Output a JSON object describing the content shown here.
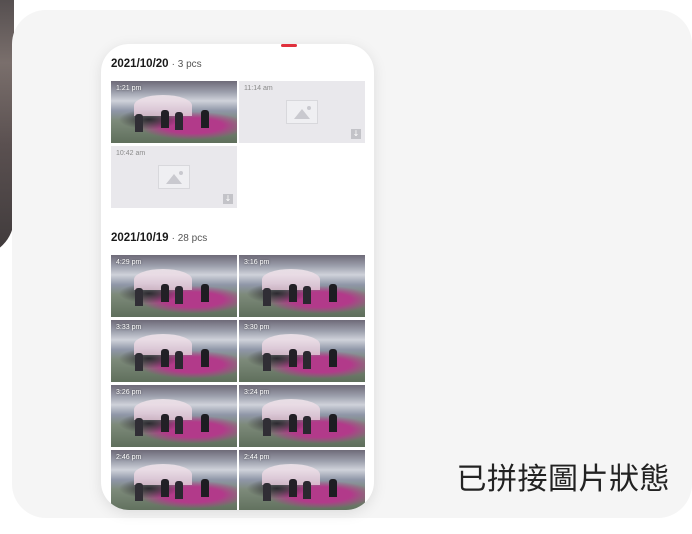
{
  "caption": "已拼接圖片狀態",
  "groups": [
    {
      "date": "2021/10/20",
      "count": "· 3 pcs",
      "items": [
        {
          "time": "1:21 pm",
          "state": "stitched"
        },
        {
          "time": "11:14 am",
          "state": "pending"
        },
        {
          "time": "10:42 am",
          "state": "pending"
        }
      ]
    },
    {
      "date": "2021/10/19",
      "count": "· 28 pcs",
      "items": [
        {
          "time": "4:29 pm",
          "state": "stitched"
        },
        {
          "time": "3:16 pm",
          "state": "stitched"
        },
        {
          "time": "3:33 pm",
          "state": "stitched"
        },
        {
          "time": "3:30 pm",
          "state": "stitched"
        },
        {
          "time": "3:26 pm",
          "state": "stitched"
        },
        {
          "time": "3:24 pm",
          "state": "stitched"
        },
        {
          "time": "2:46 pm",
          "state": "stitched"
        },
        {
          "time": "2:44 pm",
          "state": "stitched"
        }
      ]
    }
  ],
  "icons": {
    "placeholder": "image-placeholder-icon",
    "download": "download-icon"
  },
  "colors": {
    "accent": "#e0303c",
    "card_bg": "#f5f5f5",
    "placeholder_bg": "#e9e8ec"
  }
}
